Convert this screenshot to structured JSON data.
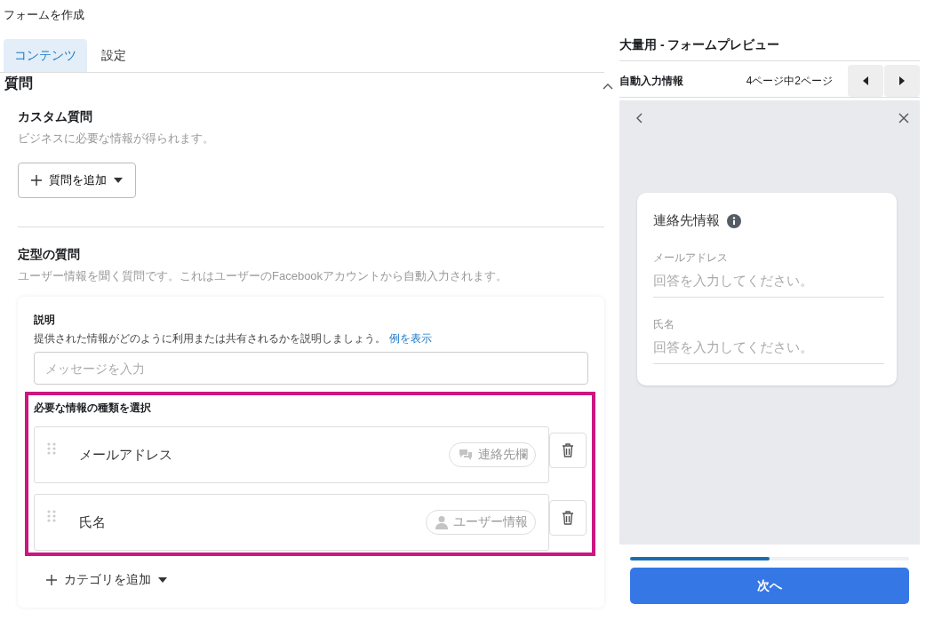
{
  "page_title": "フォームを作成",
  "tabs": [
    {
      "label": "コンテンツ",
      "selected": true
    },
    {
      "label": "設定",
      "selected": false
    }
  ],
  "questions": {
    "title": "質問",
    "expanded": true,
    "custom": {
      "title": "カスタム質問",
      "description": "ビジネスに必要な情報が得られます。",
      "add_button": "質問を追加"
    },
    "standard": {
      "title": "定型の質問",
      "description": "ユーザー情報を聞く質問です。これはユーザーのFacebookアカウントから自動入力されます。"
    },
    "intro": {
      "label": "説明",
      "help": "提供された情報がどのように利用または共有されるかを説明しましょう。",
      "link": "例を表示",
      "placeholder": "メッセージを入力"
    },
    "info_types": {
      "title": "必要な情報の種類を選択",
      "items": [
        {
          "label": "メールアドレス",
          "tag": "連絡先欄",
          "kind": "contact"
        },
        {
          "label": "氏名",
          "tag": "ユーザー情報",
          "kind": "user"
        }
      ],
      "add_button": "カテゴリを追加"
    }
  },
  "preview": {
    "title": "大量用 - フォームプレビュー",
    "section": "自動入力情報",
    "page_count": "4ページ中2ページ",
    "card_title": "連絡先情報",
    "fields": [
      {
        "label": "メールアドレス",
        "placeholder": "回答を入力してください。"
      },
      {
        "label": "氏名",
        "placeholder": "回答を入力してください。"
      }
    ],
    "progress": {
      "level": 0.5
    },
    "next_button": "次へ"
  }
}
